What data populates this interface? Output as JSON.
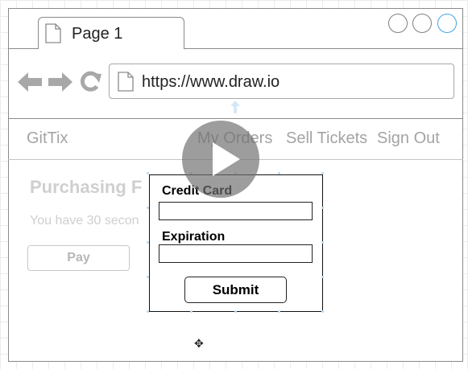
{
  "tab": {
    "label": "Page 1"
  },
  "address_bar": {
    "url": "https://www.draw.io"
  },
  "nav": {
    "brand": "GitTix",
    "my_orders": "My Orders",
    "sell_tickets": "Sell Tickets",
    "sign_out": "Sign Out"
  },
  "page": {
    "heading": "Purchasing F",
    "timer_text": "You have 30 secon",
    "pay_label": "Pay"
  },
  "modal": {
    "card_label": "Credit Card",
    "card_value": "",
    "expiration_label": "Expiration",
    "expiration_value": "",
    "submit_label": "Submit"
  },
  "icons": {
    "back": "back-arrow-icon",
    "forward": "forward-arrow-icon",
    "reload": "reload-icon",
    "document": "document-icon",
    "play": "play-icon",
    "move": "move-cursor-icon"
  },
  "colors": {
    "window_border": "#8a8a8a",
    "selection_handle": "#3fa6e8",
    "muted_text": "#a4a4a4",
    "faded_text": "#cfcfcf",
    "modal_border": "#111111"
  }
}
